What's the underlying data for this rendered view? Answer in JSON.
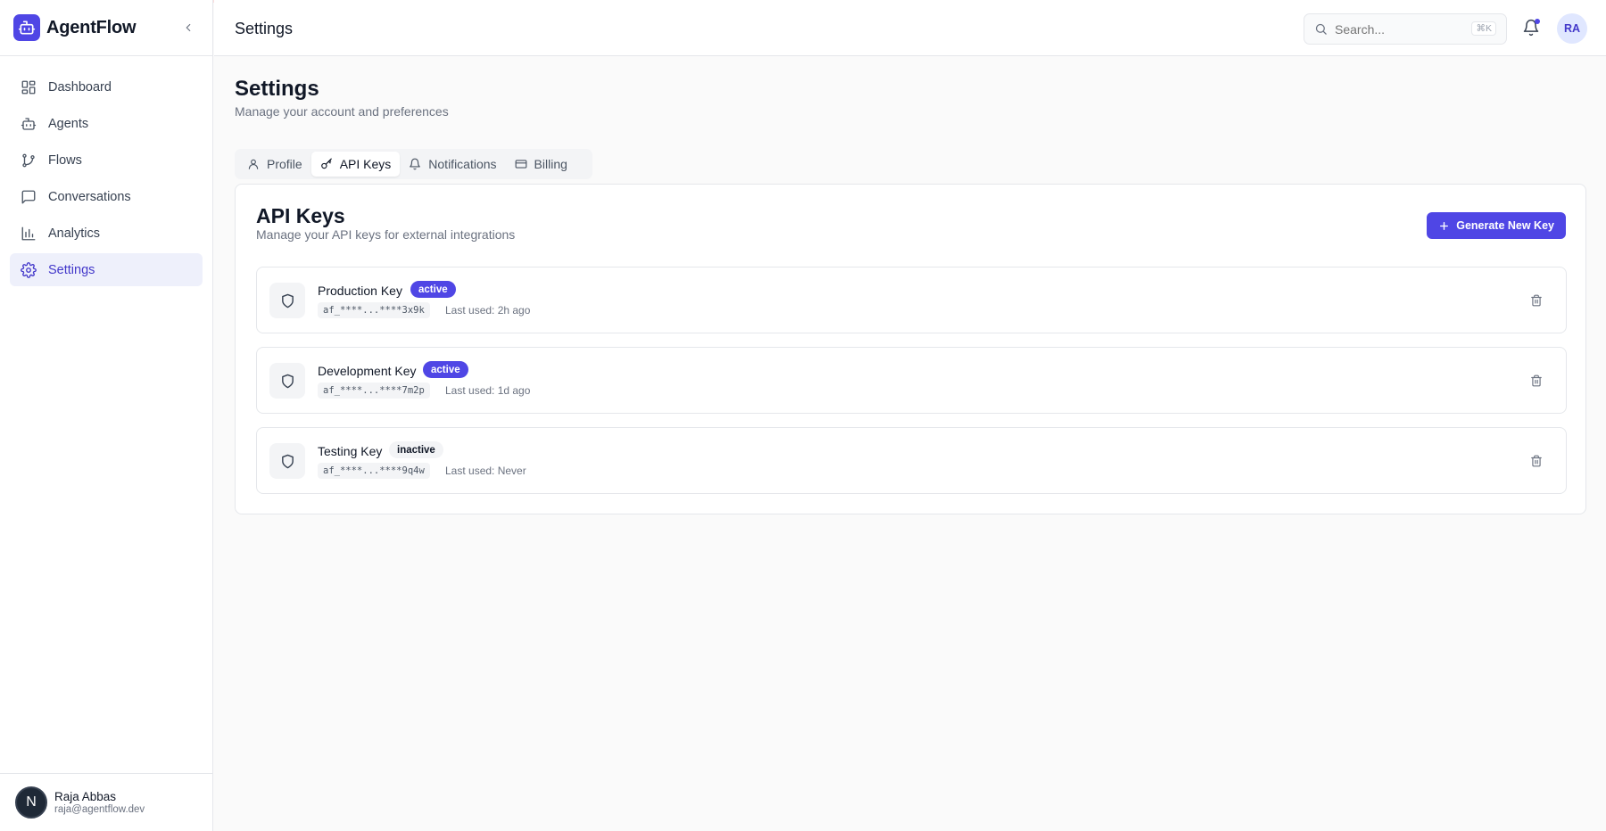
{
  "app": {
    "name": "AgentFlow"
  },
  "sidebar": {
    "items": [
      {
        "label": "Dashboard",
        "icon": "dashboard-icon"
      },
      {
        "label": "Agents",
        "icon": "bot-icon"
      },
      {
        "label": "Flows",
        "icon": "git-branch-icon"
      },
      {
        "label": "Conversations",
        "icon": "message-square-icon"
      },
      {
        "label": "Analytics",
        "icon": "bar-chart-icon"
      },
      {
        "label": "Settings",
        "icon": "gear-icon",
        "active": true
      }
    ],
    "user": {
      "initial": "N",
      "name": "Raja Abbas",
      "email": "raja@agentflow.dev"
    }
  },
  "header": {
    "title": "Settings",
    "search_placeholder": "Search...",
    "shortcut": "⌘K",
    "avatar_initials": "RA"
  },
  "page": {
    "title": "Settings",
    "subtitle": "Manage your account and preferences",
    "tabs": [
      {
        "label": "Profile",
        "icon": "user-icon"
      },
      {
        "label": "API Keys",
        "icon": "key-icon",
        "active": true
      },
      {
        "label": "Notifications",
        "icon": "bell-icon"
      },
      {
        "label": "Billing",
        "icon": "credit-card-icon"
      }
    ]
  },
  "api_keys": {
    "title": "API Keys",
    "subtitle": "Manage your API keys for external integrations",
    "generate_label": "Generate New Key",
    "keys": [
      {
        "name": "Production Key",
        "status": "active",
        "masked": "af_****...****3x9k",
        "last_used": "Last used: 2h ago"
      },
      {
        "name": "Development Key",
        "status": "active",
        "masked": "af_****...****7m2p",
        "last_used": "Last used: 1d ago"
      },
      {
        "name": "Testing Key",
        "status": "inactive",
        "masked": "af_****...****9q4w",
        "last_used": "Last used: Never"
      }
    ]
  },
  "colors": {
    "accent": "#4f46e5",
    "active_nav_bg": "#eef0fb",
    "border": "#e5e7eb",
    "muted_text": "#6b7280"
  }
}
